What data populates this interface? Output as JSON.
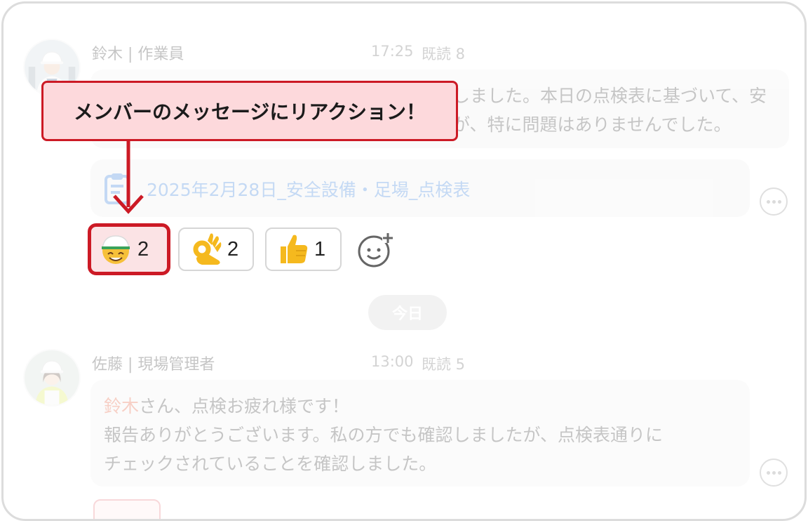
{
  "callout": {
    "text": "メンバーのメッセージにリアクション！"
  },
  "messages": [
    {
      "sender": "鈴木 | 作業員",
      "time": "17:25",
      "read": "既読 8",
      "lines": [
        "しました。本日の点検表に基づいて、安",
        "が、特に問題はありませんでした。"
      ],
      "attachment": "2025年2月28日_安全設備・足場_点検表"
    },
    {
      "sender": "佐藤 | 現場管理者",
      "time": "13:00",
      "read": "既読 5",
      "mention": "鈴木",
      "line1_rest": "さん、点検お疲れ様です！",
      "lines": [
        "報告ありがとうございます。私の方でも確認しましたが、点検表通りに",
        "チェックされていることを確認しました。"
      ]
    }
  ],
  "reactions": [
    {
      "emoji": "helmet-smile-emoji",
      "count": "2",
      "highlighted": true
    },
    {
      "emoji": "ok-hand-emoji",
      "count": "2",
      "highlighted": false
    },
    {
      "emoji": "thumbs-up-emoji",
      "count": "1",
      "highlighted": false
    }
  ],
  "date_divider": "今日",
  "colors": {
    "accent_red": "#cc1a25",
    "callout_bg": "#fdd9dc",
    "attachment_link": "#1f6fd6",
    "mention": "#e0451f"
  }
}
